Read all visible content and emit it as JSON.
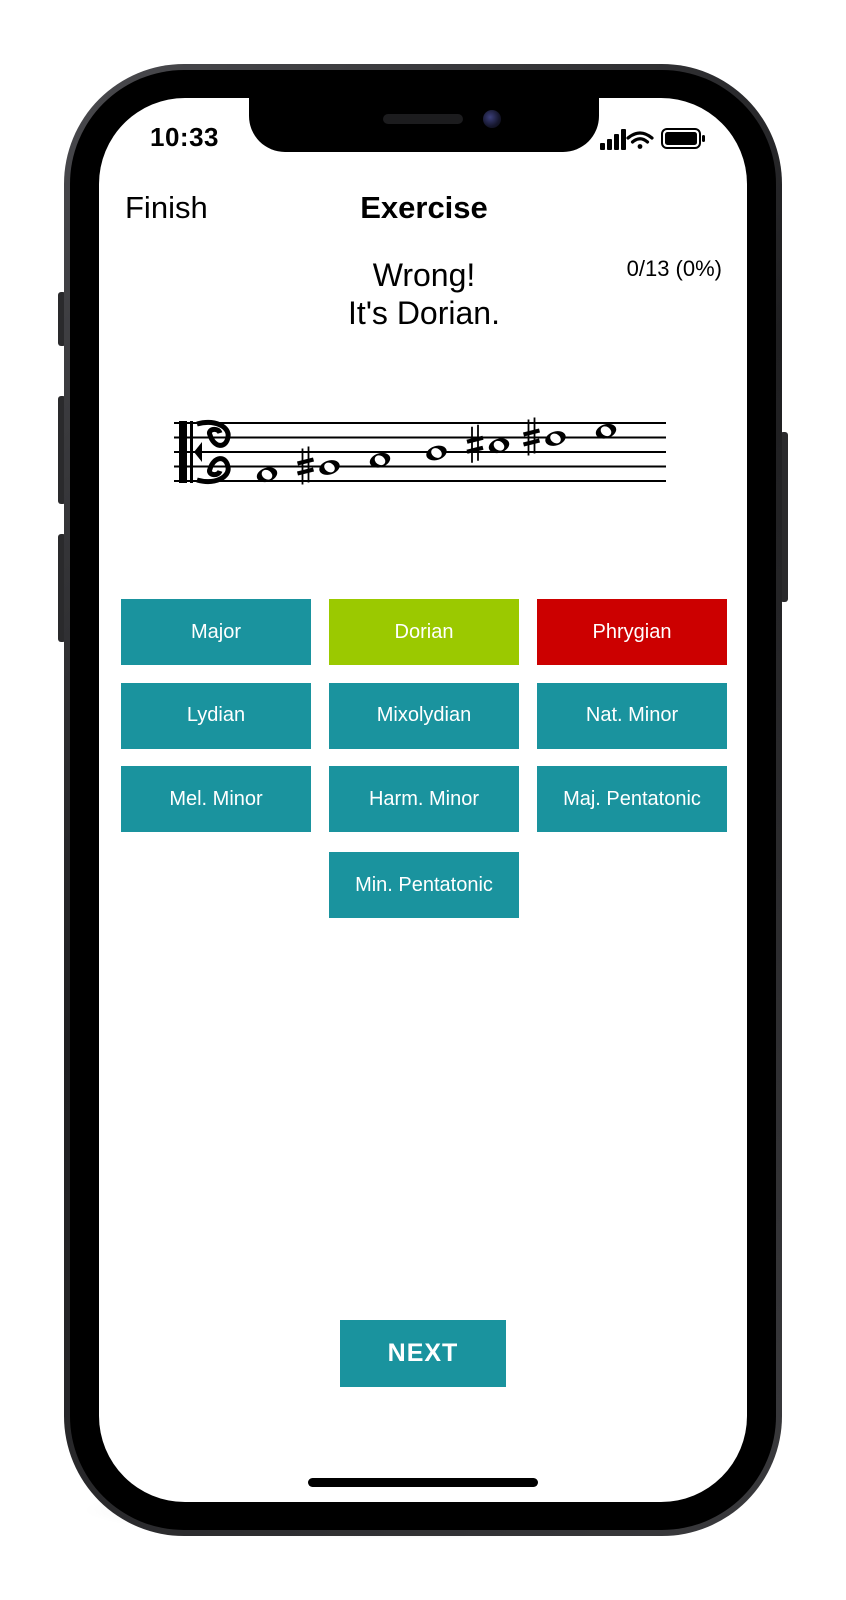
{
  "status_bar": {
    "time": "10:33",
    "icons": [
      "cellular-signal-icon",
      "wifi-icon",
      "battery-icon"
    ]
  },
  "nav": {
    "left_button": "Finish",
    "title": "Exercise"
  },
  "score": "0/13 (0%)",
  "feedback": {
    "line1": "Wrong!",
    "line2": "It's Dorian."
  },
  "notation": {
    "clef": "alto",
    "notes": [
      {
        "step": 0,
        "accidental": ""
      },
      {
        "step": 1,
        "accidental": "sharp"
      },
      {
        "step": 2,
        "accidental": ""
      },
      {
        "step": 3,
        "accidental": ""
      },
      {
        "step": 4,
        "accidental": "sharp"
      },
      {
        "step": 5,
        "accidental": "sharp"
      },
      {
        "step": 6,
        "accidental": ""
      }
    ]
  },
  "answers": [
    {
      "label": "Major",
      "state": "default"
    },
    {
      "label": "Dorian",
      "state": "correct"
    },
    {
      "label": "Phrygian",
      "state": "wrong"
    },
    {
      "label": "Lydian",
      "state": "default"
    },
    {
      "label": "Mixolydian",
      "state": "default"
    },
    {
      "label": "Nat. Minor",
      "state": "default"
    },
    {
      "label": "Mel. Minor",
      "state": "default"
    },
    {
      "label": "Harm. Minor",
      "state": "default"
    },
    {
      "label": "Maj. Pentatonic",
      "state": "default"
    },
    {
      "label": "Min. Pentatonic",
      "state": "default"
    }
  ],
  "next_button": "NEXT",
  "colors": {
    "teal": "#1a939e",
    "correct": "#9bc900",
    "wrong": "#cc0000"
  }
}
